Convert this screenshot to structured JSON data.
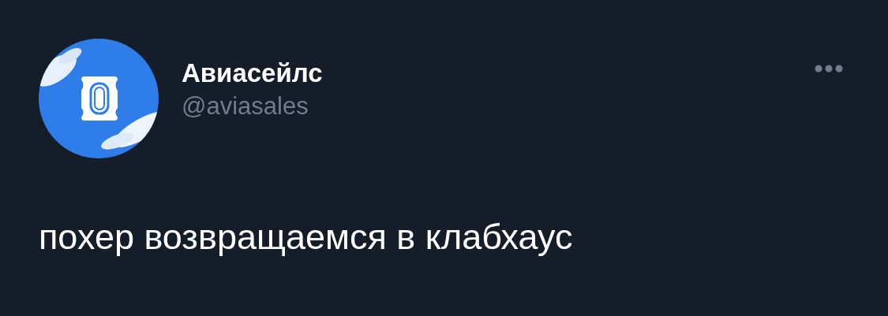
{
  "tweet": {
    "author": {
      "name": "Авиасейлс",
      "handle": "@aviasales"
    },
    "text": "похер возвращаемся в клабхаус"
  }
}
